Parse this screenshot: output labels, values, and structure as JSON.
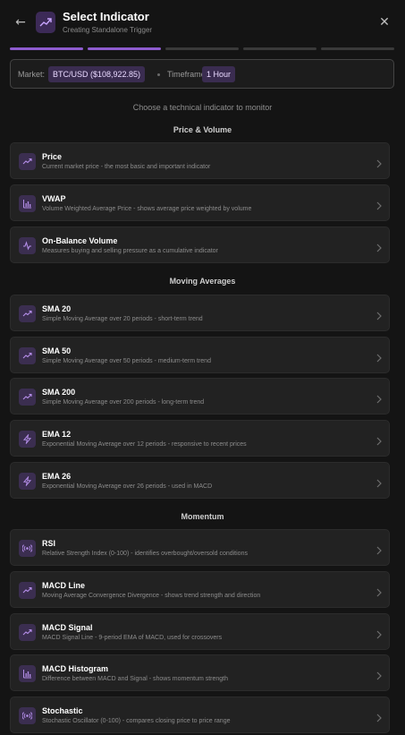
{
  "header": {
    "back_icon": "arrow-left-icon",
    "logo_icon": "trending-up-icon",
    "title": "Select Indicator",
    "subtitle": "Creating Standalone Trigger",
    "close_icon": "close-icon"
  },
  "steps": {
    "total": 5,
    "completed": 2,
    "accent": "#8e5ccf"
  },
  "context": {
    "market_label": "Market:",
    "market_value": "BTC/USD ($108,922.85)",
    "timeframe_label": "Timeframe:",
    "timeframe_value": "1 Hour"
  },
  "prompt": "Choose a technical indicator to monitor",
  "sections": [
    {
      "title": "Price & Volume",
      "items": [
        {
          "name": "Price",
          "desc": "Current market price - the most basic and important indicator",
          "icon": "trending-up-icon"
        },
        {
          "name": "VWAP",
          "desc": "Volume Weighted Average Price - shows average price weighted by volume",
          "icon": "bar-chart-icon"
        },
        {
          "name": "On-Balance Volume",
          "desc": "Measures buying and selling pressure as a cumulative indicator",
          "icon": "activity-icon"
        }
      ]
    },
    {
      "title": "Moving Averages",
      "items": [
        {
          "name": "SMA 20",
          "desc": "Simple Moving Average over 20 periods - short-term trend",
          "icon": "trending-up-icon"
        },
        {
          "name": "SMA 50",
          "desc": "Simple Moving Average over 50 periods - medium-term trend",
          "icon": "trending-up-icon"
        },
        {
          "name": "SMA 200",
          "desc": "Simple Moving Average over 200 periods - long-term trend",
          "icon": "trending-up-icon"
        },
        {
          "name": "EMA 12",
          "desc": "Exponential Moving Average over 12 periods - responsive to recent prices",
          "icon": "zap-icon"
        },
        {
          "name": "EMA 26",
          "desc": "Exponential Moving Average over 26 periods - used in MACD",
          "icon": "zap-icon"
        }
      ]
    },
    {
      "title": "Momentum",
      "items": [
        {
          "name": "RSI",
          "desc": "Relative Strength Index (0-100) - identifies overbought/oversold conditions",
          "icon": "radio-icon"
        },
        {
          "name": "MACD Line",
          "desc": "Moving Average Convergence Divergence - shows trend strength and direction",
          "icon": "trending-up-icon"
        },
        {
          "name": "MACD Signal",
          "desc": "MACD Signal Line - 9-period EMA of MACD, used for crossovers",
          "icon": "trending-up-icon"
        },
        {
          "name": "MACD Histogram",
          "desc": "Difference between MACD and Signal - shows momentum strength",
          "icon": "bar-chart-icon"
        },
        {
          "name": "Stochastic",
          "desc": "Stochastic Oscillator (0-100) - compares closing price to price range",
          "icon": "radio-icon"
        }
      ]
    }
  ]
}
